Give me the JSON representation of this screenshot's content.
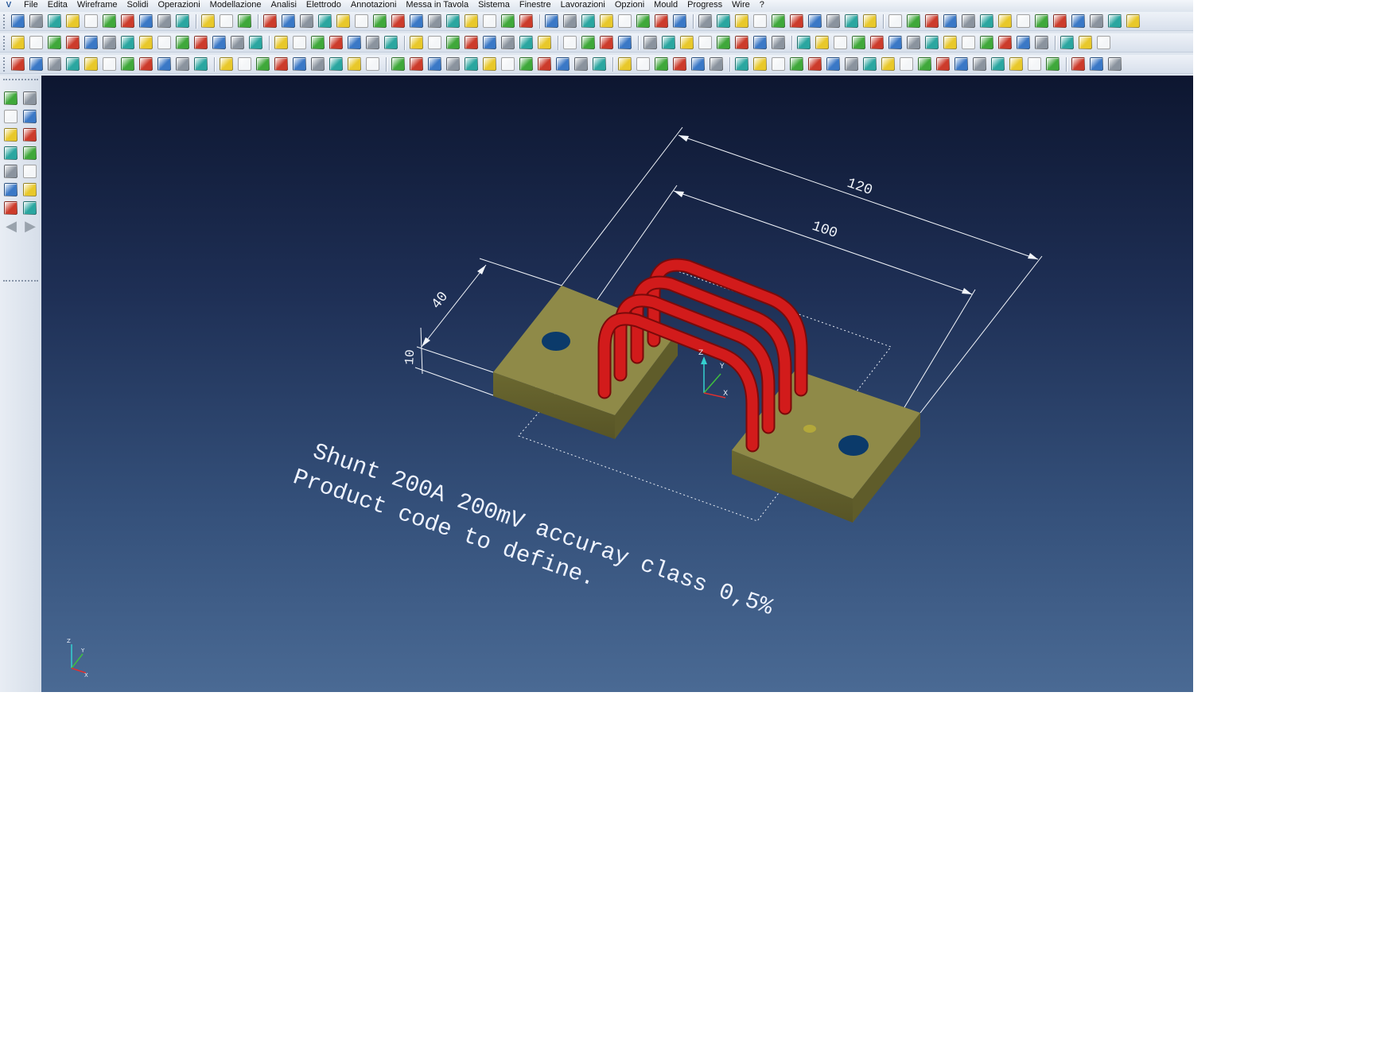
{
  "menu": {
    "app_logo": "V",
    "items": [
      "File",
      "Edita",
      "Wireframe",
      "Solidi",
      "Operazioni",
      "Modellazione",
      "Analisi",
      "Elettrodo",
      "Annotazioni",
      "Messa in Tavola",
      "Sistema",
      "Finestre",
      "Lavorazioni",
      "Opzioni",
      "Mould",
      "Progress",
      "Wire",
      "?"
    ]
  },
  "toolbar_icon_colors": {
    "blue": "#3a78c6",
    "green": "#3fa83a",
    "yellow": "#e8c82a",
    "grey": "#8a939e",
    "red": "#cc3b2b",
    "white": "#f4f6f8",
    "teal": "#2aa6a0"
  },
  "model": {
    "base_color": "#7d7a3c",
    "base_top_color": "#8f8a48",
    "bar_color": "#c51818",
    "hole_color": "#0b3a6a"
  },
  "dimensions": {
    "overall_length": "120",
    "bar_span": "100",
    "width": "40",
    "height": "10"
  },
  "annotation": {
    "line1": "Shunt 200A 200mV accuray class 0,5%",
    "line2": "Product code to define."
  },
  "triad_labels": {
    "x": "X",
    "y": "Y",
    "z": "Z"
  }
}
